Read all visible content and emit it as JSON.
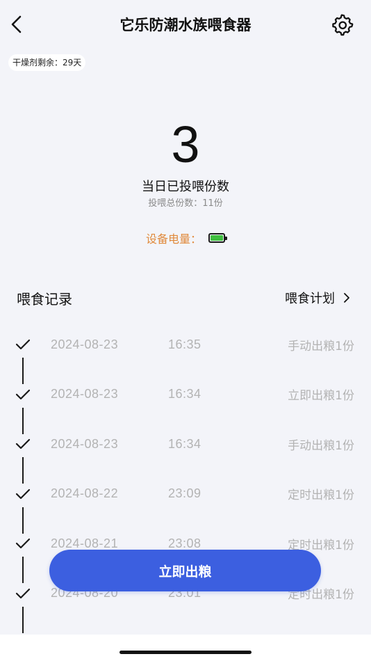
{
  "header": {
    "title": "它乐防潮水族喂食器"
  },
  "desiccant": {
    "text": "干燥剂剩余：29天"
  },
  "stats": {
    "today_count": "3",
    "today_label": "当日已投喂份数",
    "total_label": "投喂总份数：11份"
  },
  "battery": {
    "label": "设备电量：",
    "level": 1.0,
    "color": "#3fbf3f"
  },
  "records": {
    "title": "喂食记录",
    "plan_label": "喂食计划",
    "items": [
      {
        "date": "2024-08-23",
        "time": "16:35",
        "action": "手动出粮1份"
      },
      {
        "date": "2024-08-23",
        "time": "16:34",
        "action": "立即出粮1份"
      },
      {
        "date": "2024-08-23",
        "time": "16:34",
        "action": "手动出粮1份"
      },
      {
        "date": "2024-08-22",
        "time": "23:09",
        "action": "定时出粮1份"
      },
      {
        "date": "2024-08-21",
        "time": "23:08",
        "action": "定时出粮1份"
      },
      {
        "date": "2024-08-20",
        "time": "23:01",
        "action": "定时出粮1份"
      }
    ]
  },
  "feed_button": {
    "label": "立即出粮",
    "color": "#3c5fe0"
  },
  "icons": {
    "back": "chevron-left-icon",
    "settings": "gear-icon",
    "plan_arrow": "chevron-right-icon",
    "record": "check-icon",
    "battery": "battery-icon"
  }
}
